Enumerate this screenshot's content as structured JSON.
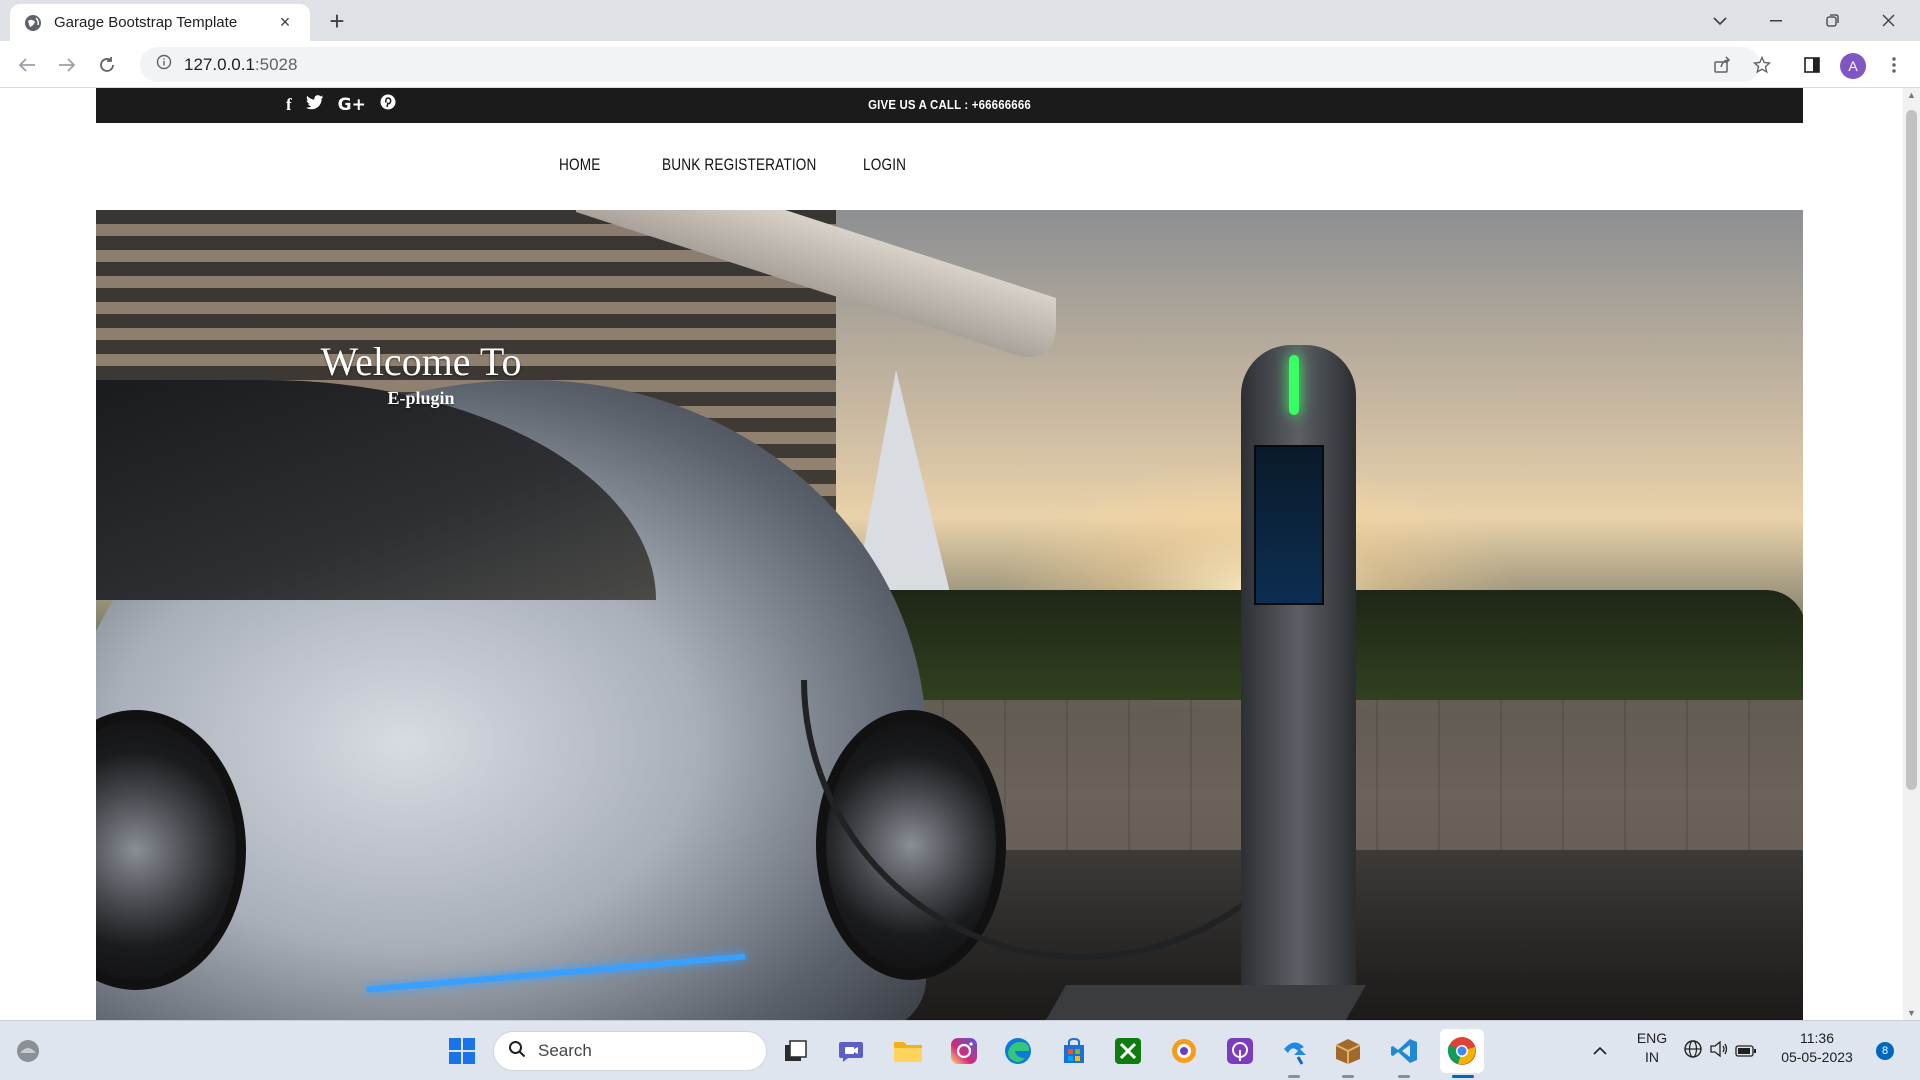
{
  "browser": {
    "tab_title": "Garage Bootstrap Template",
    "close_tab_glyph": "×",
    "new_tab_glyph": "+",
    "url_host": "127.0.0.1",
    "url_port": ":5028",
    "profile_initial": "A"
  },
  "site": {
    "topbar": {
      "social_icons": [
        {
          "name": "facebook-icon",
          "glyph": "f"
        },
        {
          "name": "twitter-icon",
          "glyph": "🐦"
        },
        {
          "name": "google-plus-icon",
          "glyph": "G+"
        },
        {
          "name": "pinterest-icon",
          "glyph": "℗"
        }
      ],
      "call_text": "GIVE US A CALL : +66666666"
    },
    "nav": {
      "items": [
        "HOME",
        "BUNK REGISTERATION",
        "LOGIN"
      ]
    },
    "hero": {
      "heading": "Welcome To",
      "subheading": "E-plugin"
    }
  },
  "taskbar": {
    "search_label": "Search",
    "language_line1": "ENG",
    "language_line2": "IN",
    "time": "11:36",
    "date": "05-05-2023",
    "notification_count": "8"
  },
  "colors": {
    "topbar_bg": "#1b1b1b",
    "nav_text": "#111111",
    "chrome_tabbar": "#dee1e6",
    "profile_purple": "#7e57c2"
  }
}
